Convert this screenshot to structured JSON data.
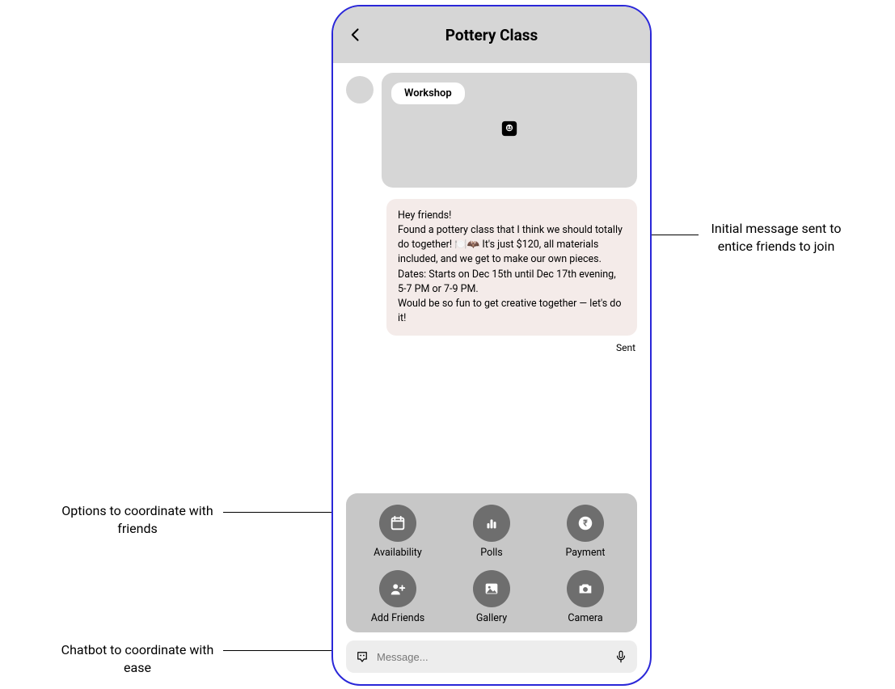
{
  "header": {
    "title": "Pottery Class"
  },
  "workshop": {
    "badge": "Workshop"
  },
  "message": {
    "body": "Hey friends!\nFound a pottery class that I think we should totally do together! 🍽️🦇 It's just $120, all materials included, and we get to make our own pieces.\nDates: Starts on Dec 15th until Dec 17th evening, 5-7 PM or 7-9 PM.\nWould be so fun to get creative together — let's do it!",
    "status": "Sent"
  },
  "actions": {
    "availability": "Availability",
    "polls": "Polls",
    "payment": "Payment",
    "add_friends": "Add Friends",
    "gallery": "Gallery",
    "camera": "Camera"
  },
  "input": {
    "placeholder": "Message..."
  },
  "annotations": {
    "right": "Initial message sent to entice friends to join",
    "left1": "Options to coordinate with friends",
    "left2": "Chatbot to coordinate with ease"
  }
}
